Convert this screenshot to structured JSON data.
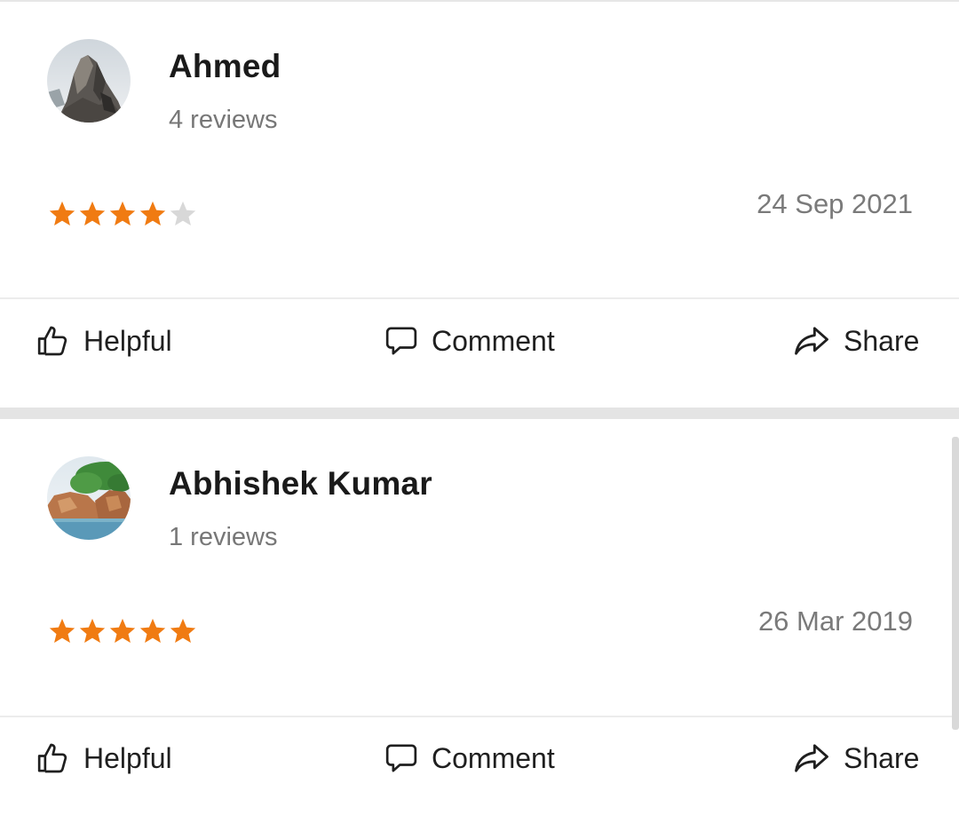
{
  "reviews": [
    {
      "user_name": "Ahmed",
      "review_count": "4 reviews",
      "rating": 4,
      "max_rating": 5,
      "date": "24 Sep 2021",
      "avatar": "rock-mountain-photo",
      "actions": {
        "helpful": "Helpful",
        "comment": "Comment",
        "share": "Share"
      }
    },
    {
      "user_name": "Abhishek Kumar",
      "review_count": "1 reviews",
      "rating": 5,
      "max_rating": 5,
      "date": "26 Mar 2019",
      "avatar": "coastal-cliff-photo",
      "actions": {
        "helpful": "Helpful",
        "comment": "Comment",
        "share": "Share"
      }
    }
  ],
  "colors": {
    "star_filled": "#F07B12",
    "star_empty": "#D8D8D8",
    "separator": "#E4E4E4"
  }
}
